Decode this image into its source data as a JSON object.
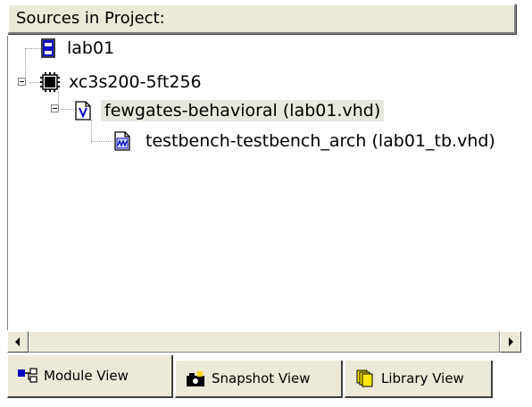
{
  "header": {
    "title": "Sources in Project:"
  },
  "tree": {
    "nodes": [
      {
        "label": "lab01",
        "icon": "project-file-icon"
      },
      {
        "label": "xc3s200-5ft256",
        "icon": "chip-icon"
      },
      {
        "label": "fewgates-behavioral (lab01.vhd)",
        "icon": "vhdl-file-icon"
      },
      {
        "label": "testbench-testbench_arch (lab01_tb.vhd)",
        "icon": "testbench-file-icon"
      }
    ]
  },
  "tabs": [
    {
      "label": "Module View",
      "icon": "module-view-icon",
      "active": true
    },
    {
      "label": "Snapshot View",
      "icon": "snapshot-icon",
      "active": false
    },
    {
      "label": "Library View",
      "icon": "library-icon",
      "active": false
    }
  ],
  "colors": {
    "panel_bg": "#ece9d8",
    "selected_bg": "#e8e7dd",
    "icon_blue": "#0000c0"
  }
}
